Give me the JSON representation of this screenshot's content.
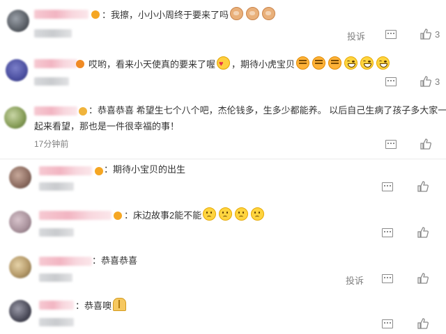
{
  "comments": [
    {
      "text": "：我擦，小小小周终于要来了吗",
      "report": "投诉",
      "likes": "3",
      "emojis": [
        "doge-icon",
        "doge-icon",
        "doge-icon"
      ]
    },
    {
      "text": "哎哟，看来小天使真的要来了喔",
      "text2": "，期待小虎宝贝",
      "likes": "3"
    },
    {
      "text_line1": "：恭喜恭喜 希望生七个八个吧，杰伦钱多，生多少都能养。 以后自己生病了孩子多大家一",
      "text_line2": "起来看望，那也是一件很幸福的事！",
      "time": "17分钟前"
    },
    {
      "text": "：期待小宝贝的出生"
    },
    {
      "text": "：床边故事2能不能"
    },
    {
      "text": "：恭喜恭喜",
      "report": "投诉"
    },
    {
      "text": "：恭喜噢"
    }
  ]
}
